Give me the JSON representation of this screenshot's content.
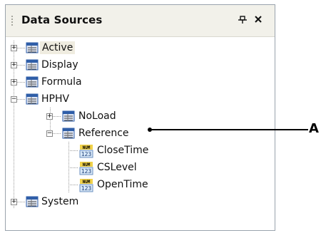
{
  "panel": {
    "title": "Data Sources",
    "pin_icon": "pin-icon",
    "close_icon": "close-icon"
  },
  "tree": {
    "nodes": [
      {
        "label": "Active",
        "type": "folder",
        "expanded": false,
        "selected": true
      },
      {
        "label": "Display",
        "type": "folder",
        "expanded": false
      },
      {
        "label": "Formula",
        "type": "folder",
        "expanded": false
      },
      {
        "label": "HPHV",
        "type": "folder",
        "expanded": true,
        "children": [
          {
            "label": "NoLoad",
            "type": "folder",
            "expanded": false
          },
          {
            "label": "Reference",
            "type": "folder",
            "expanded": true,
            "children": [
              {
                "label": "CloseTime",
                "type": "numeric",
                "icon_text_top": "NUM",
                "icon_text_bottom": "123"
              },
              {
                "label": "CSLevel",
                "type": "numeric",
                "icon_text_top": "NUM",
                "icon_text_bottom": "123"
              },
              {
                "label": "OpenTime",
                "type": "numeric",
                "icon_text_top": "NUM",
                "icon_text_bottom": "123"
              }
            ]
          }
        ]
      },
      {
        "label": "System",
        "type": "folder",
        "expanded": false
      }
    ]
  },
  "annotation": {
    "label": "A"
  },
  "colors": {
    "panel_border": "#9aa3ad",
    "titlebar_bg": "#f2f1ea",
    "selected_bg": "#efece0",
    "folder_icon_blue": "#2f5ea8",
    "num_icon_yellow": "#f1d24a"
  }
}
